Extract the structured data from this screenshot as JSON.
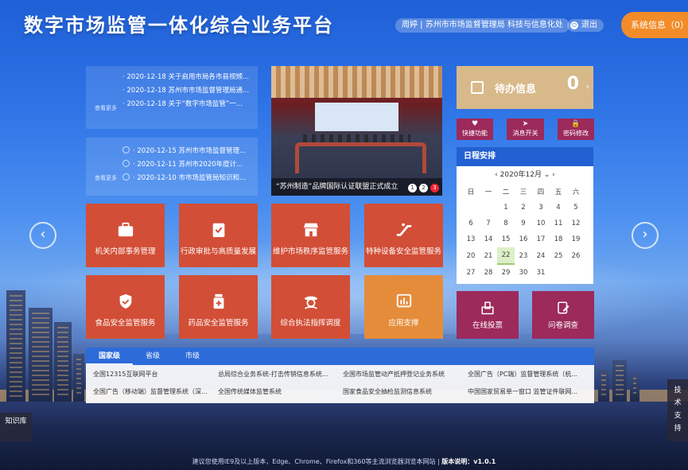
{
  "header": {
    "title": "数字市场监管一体化综合业务平台",
    "user": "周婷 | 苏州市市场监督管理局 科技与信息化处",
    "logout": "退出",
    "system_info": "系统信息（0）"
  },
  "notice": {
    "badge": "通告",
    "more": "查看更多",
    "items": [
      "· 2020-12-18 关于启用市局各市县视频...",
      "· 2020-12-18 苏州市市场监督管理局通...",
      "· 2020-12-18 关于“数字市场监管”一..."
    ]
  },
  "news": {
    "badge": "新闻",
    "more": "查看更多",
    "items": [
      "· 2020-12-15 苏州市市场监督管理...",
      "· 2020-12-11 苏州市2020年度计...",
      "· 2020-12-10 市市场监管局知识和..."
    ]
  },
  "carousel": {
    "caption": "“苏州制造”品牌国际认证联盟正式成立",
    "pages": [
      "1",
      "2",
      "3"
    ]
  },
  "tiles": [
    {
      "label": "机关内部事务管理",
      "icon": "briefcase-icon"
    },
    {
      "label": "行政审批与高质量发展",
      "icon": "clipboard-check-icon"
    },
    {
      "label": "维护市场秩序监管服务",
      "icon": "storefront-icon"
    },
    {
      "label": "特种设备安全监管服务",
      "icon": "escalator-icon"
    },
    {
      "label": "食品安全监管服务",
      "icon": "shield-icon"
    },
    {
      "label": "药品安全监管服务",
      "icon": "pill-bottle-icon"
    },
    {
      "label": "综合执法指挥调度",
      "icon": "officer-icon"
    },
    {
      "label": "应用支撑",
      "icon": "chart-icon"
    }
  ],
  "pending": {
    "label": "待办信息",
    "count": "0"
  },
  "quick": [
    {
      "label": "快捷功能",
      "symbol": "♥"
    },
    {
      "label": "消息开关",
      "symbol": "➤"
    },
    {
      "label": "密码修改",
      "symbol": "🔒"
    }
  ],
  "calendar": {
    "header": "日程安排",
    "month": "‹  2020年12月  ⌄  ›",
    "weekdays": [
      "日",
      "一",
      "二",
      "三",
      "四",
      "五",
      "六"
    ],
    "weeks": [
      [
        "",
        "",
        "1",
        "2",
        "3",
        "4",
        "5"
      ],
      [
        "6",
        "7",
        "8",
        "9",
        "10",
        "11",
        "12"
      ],
      [
        "13",
        "14",
        "15",
        "16",
        "17",
        "18",
        "19"
      ],
      [
        "20",
        "21",
        "22",
        "23",
        "24",
        "25",
        "26"
      ],
      [
        "27",
        "28",
        "29",
        "30",
        "31",
        "",
        ""
      ]
    ],
    "today": "22"
  },
  "bottom_buttons": [
    {
      "label": "在线投票"
    },
    {
      "label": "问卷调查"
    }
  ],
  "links": {
    "tabs": [
      "国家级",
      "省级",
      "市级"
    ],
    "items": [
      "全国12315互联网平台",
      "总局综合业务系统-打击传销信息系统...",
      "全国市场监管动产抵押登记业务系统",
      "全国广告（PC端）监督管理系统（杭...",
      "全国广告（移动端）监督管理系统（深...",
      "全国传统媒体监管系统",
      "国家食品安全抽检监测信息系统",
      "中国国家贸易单一窗口 监管证件联网..."
    ]
  },
  "side": {
    "left": "知识库",
    "right": "技术支持"
  },
  "footer": {
    "hint": "建议您使用IE9及以上版本，Edge、Chrome、Firefox和360等主流浏览器浏览本网站",
    "version": "版本说明：v1.0.1"
  }
}
